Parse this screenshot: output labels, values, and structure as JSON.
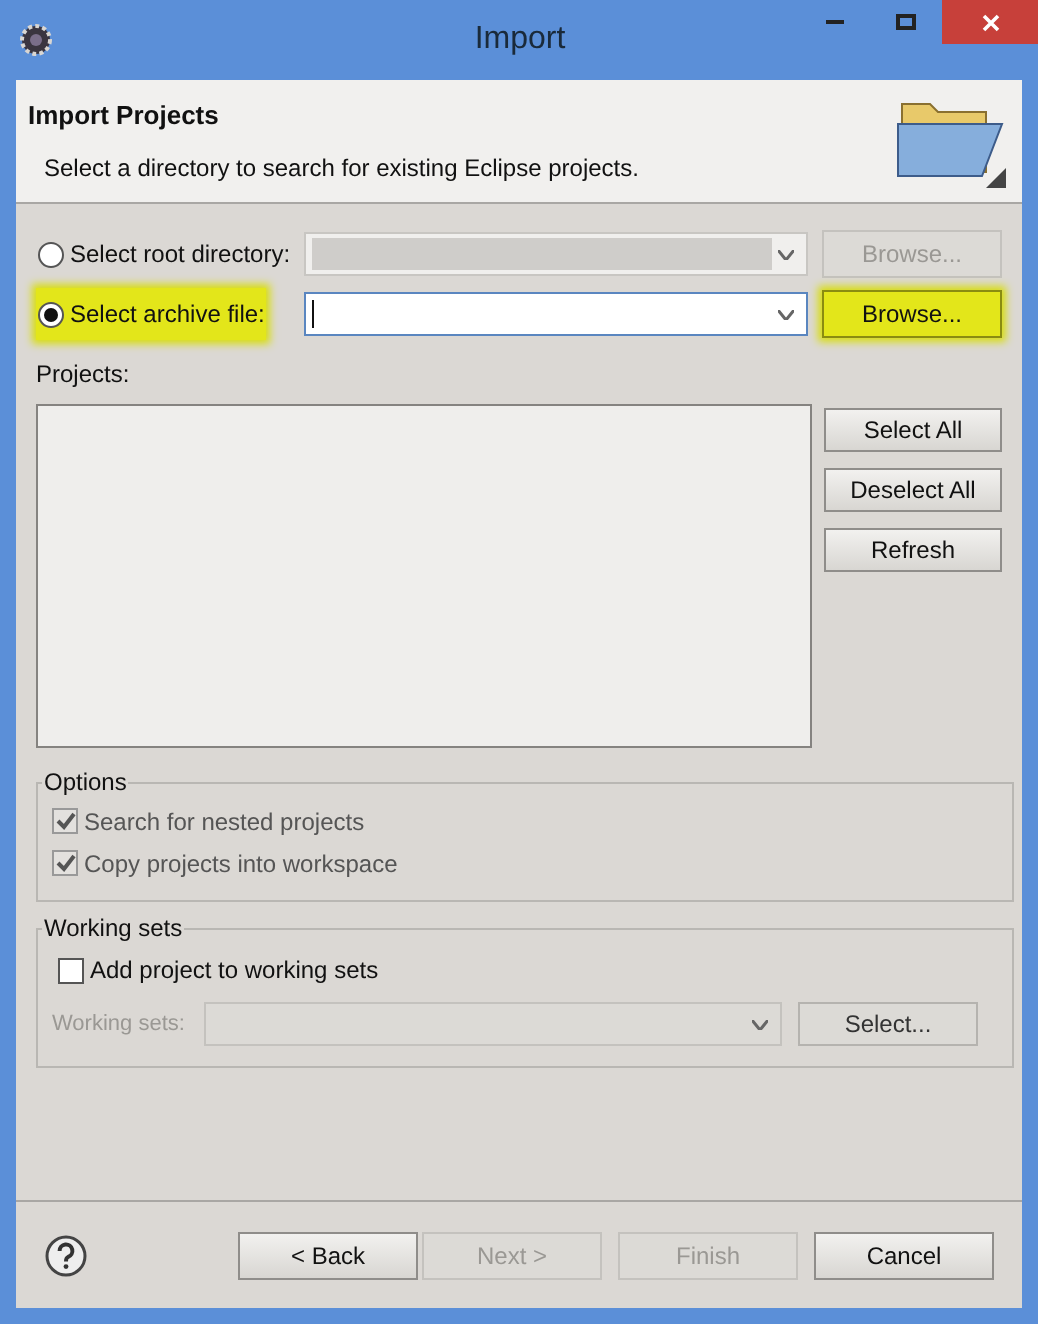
{
  "window": {
    "title": "Import"
  },
  "header": {
    "title": "Import Projects",
    "description": "Select a directory to search for existing Eclipse projects."
  },
  "source_options": [
    {
      "label": "Select root directory:",
      "selected": false,
      "highlighted": false,
      "field": {
        "disabled": true,
        "focused": false
      },
      "button": {
        "label": "Browse...",
        "disabled": true,
        "highlighted": false
      }
    },
    {
      "label": "Select archive file:",
      "selected": true,
      "highlighted": true,
      "field": {
        "disabled": false,
        "focused": true
      },
      "button": {
        "label": "Browse...",
        "disabled": false,
        "highlighted": true
      }
    }
  ],
  "projects": {
    "label": "Projects:",
    "buttons": [
      "Select All",
      "Deselect All",
      "Refresh"
    ]
  },
  "options": {
    "title": "Options",
    "items": [
      {
        "label": "Search for nested projects",
        "checked": true,
        "disabled": true
      },
      {
        "label": "Copy projects into workspace",
        "checked": true,
        "disabled": true
      }
    ]
  },
  "working_sets": {
    "title": "Working sets",
    "checkbox": {
      "label": "Add project to working sets",
      "checked": false
    },
    "field": {
      "label": "Working sets:",
      "disabled": true
    },
    "button": {
      "label": "Select...",
      "disabled": false
    }
  },
  "footer": {
    "buttons": [
      {
        "label": "< Back",
        "disabled": false
      },
      {
        "label": "Next >",
        "disabled": true
      },
      {
        "label": "Finish",
        "disabled": true
      },
      {
        "label": "Cancel",
        "disabled": false
      }
    ]
  }
}
